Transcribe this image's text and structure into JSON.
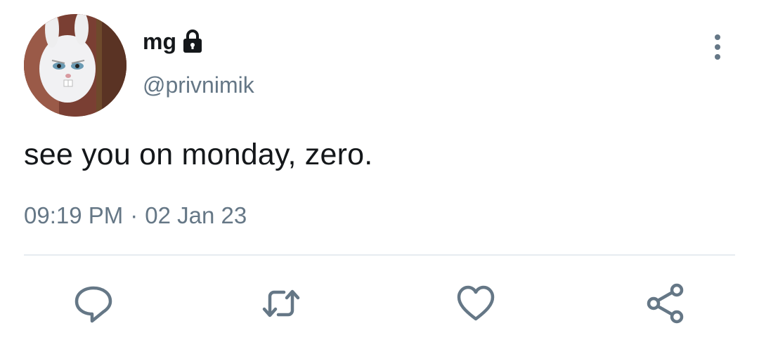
{
  "tweet": {
    "author": {
      "display_name": "mg",
      "handle": "@privnimik",
      "protected_icon": "lock-icon",
      "avatar_icon": "avatar-white-rabbit"
    },
    "text": "see you on monday, zero.",
    "time": "09:19 PM",
    "separator": "·",
    "date": "02 Jan 23"
  },
  "actions": [
    {
      "name": "reply",
      "icon": "reply-icon"
    },
    {
      "name": "retweet",
      "icon": "retweet-icon"
    },
    {
      "name": "like",
      "icon": "heart-icon"
    },
    {
      "name": "share",
      "icon": "share-icon"
    }
  ],
  "colors": {
    "primary_text": "#14171a",
    "secondary_text": "#657786",
    "icon": "#657786",
    "divider": "#e6ecf0"
  }
}
